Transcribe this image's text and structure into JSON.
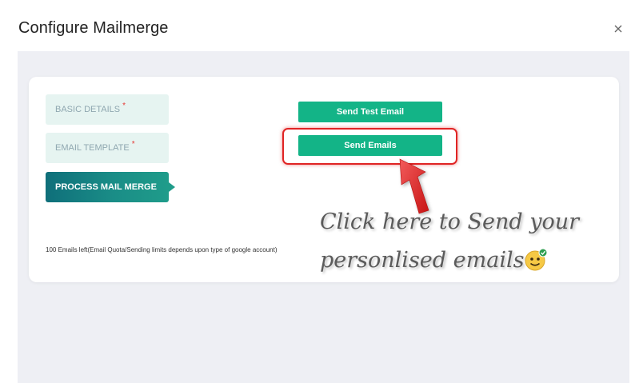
{
  "modal": {
    "title": "Configure Mailmerge",
    "close_label": "×"
  },
  "steps": [
    {
      "label": "BASIC DETAILS",
      "required": "*",
      "state": "inactive"
    },
    {
      "label": "EMAIL TEMPLATE",
      "required": "*",
      "state": "inactive"
    },
    {
      "label": "PROCESS MAIL MERGE",
      "state": "active"
    }
  ],
  "quota_note": "100 Emails left(Email Quota/Sending limits depends upon type of google account)",
  "actions": {
    "send_test_label": "Send Test Email",
    "send_emails_label": "Send Emails"
  },
  "annotation": {
    "line1": "Click here to Send your",
    "line2": "personlised emails",
    "emoji_icon": "smiley-face-with-check-icon"
  },
  "colors": {
    "primary_green": "#13b487",
    "active_step": "#0f6f7a",
    "inactive_step_bg": "#e6f4f1",
    "highlight_red": "#e02424",
    "body_bg": "#eeeff4"
  }
}
